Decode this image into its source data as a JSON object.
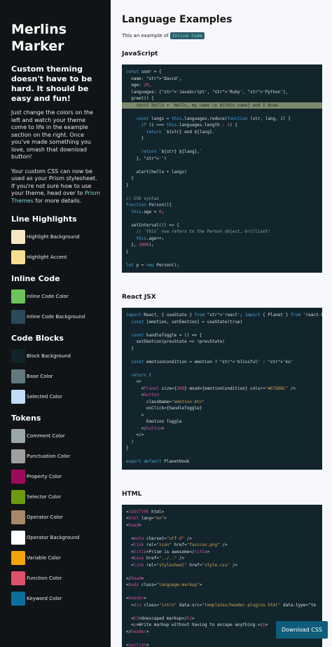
{
  "sidebar": {
    "brand_line1": "Merlins",
    "brand_line2": "Marker",
    "tagline": "Custom theming doesn't have to be hard. It should be easy and fun!",
    "para1": "Just change the colors on the left and watch your theme come to life in the example section on the right. Once you've made something you love, smash that download button!",
    "para2_before": "Your custom CSS can now be used as your Prism stylesheet. If you're not sure how to use your theme, head over to ",
    "para2_link": "Prism Themes",
    "para2_after": " for more details.",
    "sections": [
      {
        "title": "Line Highlights",
        "items": [
          {
            "label": "Highlight Background",
            "color": "#f6e8c3"
          },
          {
            "label": "Highlight Accent",
            "color": "#f7dd8f"
          }
        ]
      },
      {
        "title": "Inline Code",
        "items": [
          {
            "label": "Inline Code Color",
            "color": "#6ec45c"
          },
          {
            "label": "Inline Code Background",
            "color": "#2a4a5a"
          }
        ]
      },
      {
        "title": "Code Blocks",
        "items": [
          {
            "label": "Block Background",
            "color": "#0f2328"
          },
          {
            "label": "Base Color",
            "color": "#627a7e"
          },
          {
            "label": "Selected Color",
            "color": "#c2dcfa"
          }
        ]
      },
      {
        "title": "Tokens",
        "items": [
          {
            "label": "Comment Color",
            "color": "#9aa7a9"
          },
          {
            "label": "Punctuation Color",
            "color": "#9f9f9f"
          },
          {
            "label": "Property Color",
            "color": "#9e0a5a"
          },
          {
            "label": "Selector Color",
            "color": "#6c9a10"
          },
          {
            "label": "Operator Color",
            "color": "#a78868"
          },
          {
            "label": "Operator Background",
            "color": "#ffffff"
          },
          {
            "label": "Variable Color",
            "color": "#f2a40a"
          },
          {
            "label": "Function Color",
            "color": "#e0506a"
          },
          {
            "label": "Keyword Color",
            "color": "#0b6f9e"
          }
        ]
      }
    ]
  },
  "main": {
    "title": "Language Examples",
    "intro_text": "This an example of ",
    "intro_code": "Inline Code",
    "download_label": "Download CSS",
    "langs": [
      {
        "title": "JavaScript",
        "lines": [
          {
            "t": "const user = {",
            "h": false
          },
          {
            "t": "  name: 'David',",
            "h": false
          },
          {
            "t": "  age: 20,",
            "h": false
          },
          {
            "t": "  languages: ['JavaScript', 'Ruby', 'Python'],",
            "h": false
          },
          {
            "t": "  greet() {",
            "h": false
          },
          {
            "t": "    const hello = `Hello, my name is ${this.name} and I know`",
            "h": true
          },
          {
            "t": "",
            "h": false
          },
          {
            "t": "    const langs = this.languages.reduce(function (str, lang, i) {",
            "h": false
          },
          {
            "t": "      if (i === this.languages.length - 1) {",
            "h": false
          },
          {
            "t": "        return `${str} and ${lang}.`",
            "h": false
          },
          {
            "t": "      }",
            "h": false
          },
          {
            "t": "",
            "h": false
          },
          {
            "t": "      return `${str} ${lang},`",
            "h": false
          },
          {
            "t": "    }, '')",
            "h": false
          },
          {
            "t": "",
            "h": false
          },
          {
            "t": "    alert(hello + langs)",
            "h": false
          },
          {
            "t": "  }",
            "h": false
          },
          {
            "t": "}",
            "h": false
          },
          {
            "t": "",
            "h": false
          },
          {
            "t": "// ES6 syntax",
            "h": false
          },
          {
            "t": "function Person(){",
            "h": false
          },
          {
            "t": "  this.age = 0;",
            "h": false
          },
          {
            "t": "",
            "h": false
          },
          {
            "t": "  setInterval(() => {",
            "h": false
          },
          {
            "t": "    // `this` now refers to the Person object, brilliant!",
            "h": false
          },
          {
            "t": "    this.age++;",
            "h": false
          },
          {
            "t": "  }, 1000);",
            "h": false
          },
          {
            "t": "}",
            "h": false
          },
          {
            "t": "",
            "h": false
          },
          {
            "t": "let p = new Person();",
            "h": false
          }
        ]
      },
      {
        "title": "React JSX",
        "lines": [
          {
            "t": "import React, { useState } from 'react'; import { Planet } from 'react-kaw",
            "h": false
          },
          {
            "t": "  const [emotion, setEmotion] = useState(true)",
            "h": false
          },
          {
            "t": "",
            "h": false
          },
          {
            "t": "  const handleToggle = () => {",
            "h": false
          },
          {
            "t": "    setEmotion(prevState => !prevState)",
            "h": false
          },
          {
            "t": "  }",
            "h": false
          },
          {
            "t": "",
            "h": false
          },
          {
            "t": "  const emotionCondition = emotion ? 'blissful' : 'ko'",
            "h": false
          },
          {
            "t": "",
            "h": false
          },
          {
            "t": "  return (",
            "h": false
          },
          {
            "t": "    <>",
            "h": false
          },
          {
            "t": "      <Planet size={200} mood={emotionCondition} color=\"#67DDBC\" />",
            "h": false
          },
          {
            "t": "      <button",
            "h": false
          },
          {
            "t": "        className=\"emotion-btn\"",
            "h": false
          },
          {
            "t": "        onClick={handleToggle}",
            "h": false
          },
          {
            "t": "      >",
            "h": false
          },
          {
            "t": "        Emotion Toggle",
            "h": false
          },
          {
            "t": "      </button>",
            "h": false
          },
          {
            "t": "    </>",
            "h": false
          },
          {
            "t": "  )",
            "h": false
          },
          {
            "t": "}",
            "h": false
          },
          {
            "t": "",
            "h": false
          },
          {
            "t": "export default PlanetHook",
            "h": false
          }
        ]
      },
      {
        "title": "HTML",
        "lines": [
          {
            "t": "<!DOCTYPE html>",
            "h": false
          },
          {
            "t": "<html lang=\"en\">",
            "h": false
          },
          {
            "t": "<head>",
            "h": false
          },
          {
            "t": "",
            "h": false
          },
          {
            "t": "  <meta charset=\"utf-8\" />",
            "h": false
          },
          {
            "t": "  <link rel=\"icon\" href=\"favicon.png\" />",
            "h": false
          },
          {
            "t": "  <title>Prism is awesome</title>",
            "h": false
          },
          {
            "t": "  <base href=\"../..\" />",
            "h": false
          },
          {
            "t": "  <link rel=\"stylesheet\" href=\"style.css\" />",
            "h": false
          },
          {
            "t": "",
            "h": false
          },
          {
            "t": "</head>",
            "h": false
          },
          {
            "t": "<body class=\"language-markup\">",
            "h": false
          },
          {
            "t": "",
            "h": false
          },
          {
            "t": "<header>",
            "h": false
          },
          {
            "t": "  <div class=\"intro\" data-src=\"templates/header-plugins.html\" data-type=\"te",
            "h": false
          },
          {
            "t": "",
            "h": false
          },
          {
            "t": "  <h2>Unescaped markup</h2>",
            "h": false
          },
          {
            "t": "  <p>Write markup without having to escape anything.</p>",
            "h": false
          },
          {
            "t": "</header>",
            "h": false
          },
          {
            "t": "",
            "h": false
          },
          {
            "t": "<section>",
            "h": false
          }
        ]
      }
    ]
  }
}
